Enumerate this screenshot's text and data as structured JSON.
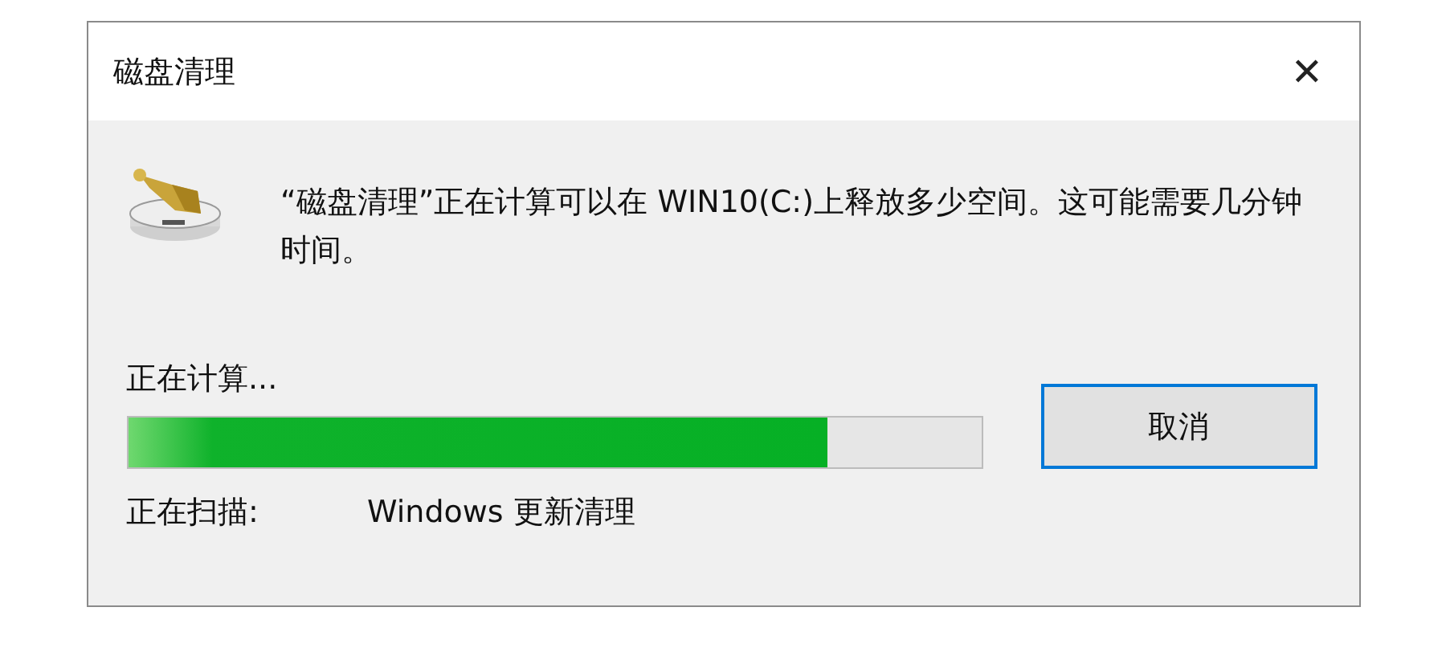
{
  "window": {
    "title": "磁盘清理",
    "close": "✕"
  },
  "message": "“磁盘清理”正在计算可以在 WIN10(C:)上释放多少空间。这可能需要几分钟时间。",
  "status": "正在计算...",
  "progress": {
    "level": 0.82
  },
  "scan": {
    "label": "正在扫描:",
    "value": "Windows 更新清理"
  },
  "buttons": [
    {
      "label": "取消",
      "focused": true
    }
  ]
}
